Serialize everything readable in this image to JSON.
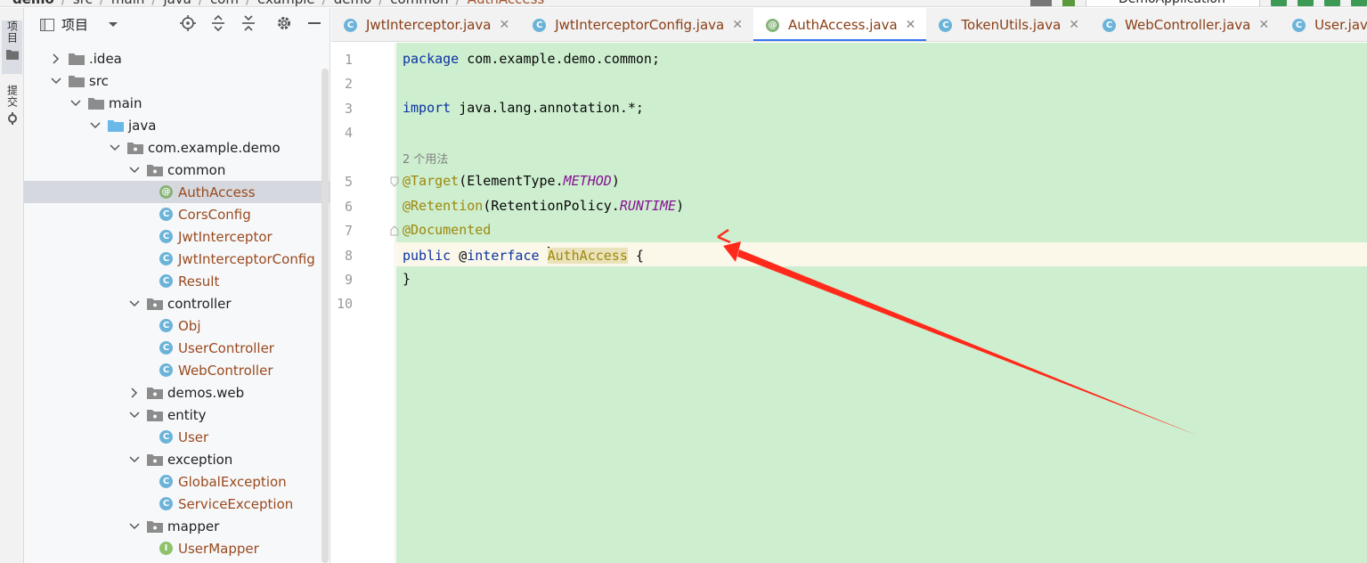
{
  "breadcrumb": {
    "items": [
      "demo",
      "src",
      "main",
      "java",
      "com",
      "example",
      "demo",
      "common",
      "AuthAccess"
    ]
  },
  "run_config": {
    "label": "DemoApplication"
  },
  "tool_strip": {
    "project_label": "项目",
    "commit_label": "提交"
  },
  "project_panel": {
    "title": "项目",
    "tree": [
      {
        "label": ".idea",
        "kind": "folder",
        "depth": 0,
        "expanded": false
      },
      {
        "label": "src",
        "kind": "folder",
        "depth": 0,
        "expanded": true
      },
      {
        "label": "main",
        "kind": "folder",
        "depth": 1,
        "expanded": true
      },
      {
        "label": "java",
        "kind": "source-folder",
        "depth": 2,
        "expanded": true
      },
      {
        "label": "com.example.demo",
        "kind": "package",
        "depth": 3,
        "expanded": true
      },
      {
        "label": "common",
        "kind": "package",
        "depth": 4,
        "expanded": true
      },
      {
        "label": "AuthAccess",
        "kind": "annotation",
        "depth": 5,
        "selected": true
      },
      {
        "label": "CorsConfig",
        "kind": "class",
        "depth": 5
      },
      {
        "label": "JwtInterceptor",
        "kind": "class",
        "depth": 5
      },
      {
        "label": "JwtInterceptorConfig",
        "kind": "class",
        "depth": 5
      },
      {
        "label": "Result",
        "kind": "class",
        "depth": 5
      },
      {
        "label": "controller",
        "kind": "package",
        "depth": 4,
        "expanded": true
      },
      {
        "label": "Obj",
        "kind": "class",
        "depth": 5
      },
      {
        "label": "UserController",
        "kind": "class",
        "depth": 5
      },
      {
        "label": "WebController",
        "kind": "class",
        "depth": 5
      },
      {
        "label": "demos.web",
        "kind": "package",
        "depth": 4,
        "expanded": false
      },
      {
        "label": "entity",
        "kind": "package",
        "depth": 4,
        "expanded": true
      },
      {
        "label": "User",
        "kind": "class",
        "depth": 5
      },
      {
        "label": "exception",
        "kind": "package",
        "depth": 4,
        "expanded": true
      },
      {
        "label": "GlobalException",
        "kind": "class",
        "depth": 5
      },
      {
        "label": "ServiceException",
        "kind": "class",
        "depth": 5
      },
      {
        "label": "mapper",
        "kind": "package",
        "depth": 4,
        "expanded": true
      },
      {
        "label": "UserMapper",
        "kind": "interface",
        "depth": 5
      }
    ]
  },
  "tabs": [
    {
      "label": "JwtInterceptor.java",
      "kind": "class",
      "active": false
    },
    {
      "label": "JwtInterceptorConfig.java",
      "kind": "class",
      "active": false
    },
    {
      "label": "AuthAccess.java",
      "kind": "annotation",
      "active": true
    },
    {
      "label": "TokenUtils.java",
      "kind": "class",
      "active": false
    },
    {
      "label": "WebController.java",
      "kind": "class",
      "active": false
    },
    {
      "label": "User.java",
      "kind": "class",
      "active": false
    }
  ],
  "editor": {
    "line_numbers": [
      "1",
      "2",
      "3",
      "4",
      "5",
      "6",
      "7",
      "8",
      "9",
      "10"
    ],
    "usage_hint": "2 个用法",
    "code": {
      "l1_kw": "package",
      "l1_rest": " com.example.demo.common;",
      "l3_kw": "import",
      "l3_rest": " java.lang.annotation.*;",
      "l5_anno": "@Target",
      "l5_a": "(ElementType.",
      "l5_it": "METHOD",
      "l5_b": ")",
      "l6_anno": "@Retention",
      "l6_a": "(RetentionPolicy.",
      "l6_it": "RUNTIME",
      "l6_b": ")",
      "l7_anno": "@Documented",
      "l8_kw1": "public",
      "l8_at": " @",
      "l8_kw2": "interface",
      "l8_sp": " ",
      "l8_ident": "AuthAccess",
      "l8_rest": " {",
      "l9": "}"
    }
  },
  "colors": {
    "code_background": "#cdeecf",
    "keyword": "#0b33a3",
    "annotation": "#9e880d",
    "arrow": "#ff2a1a",
    "active_tab_underline": "#3574f0"
  }
}
